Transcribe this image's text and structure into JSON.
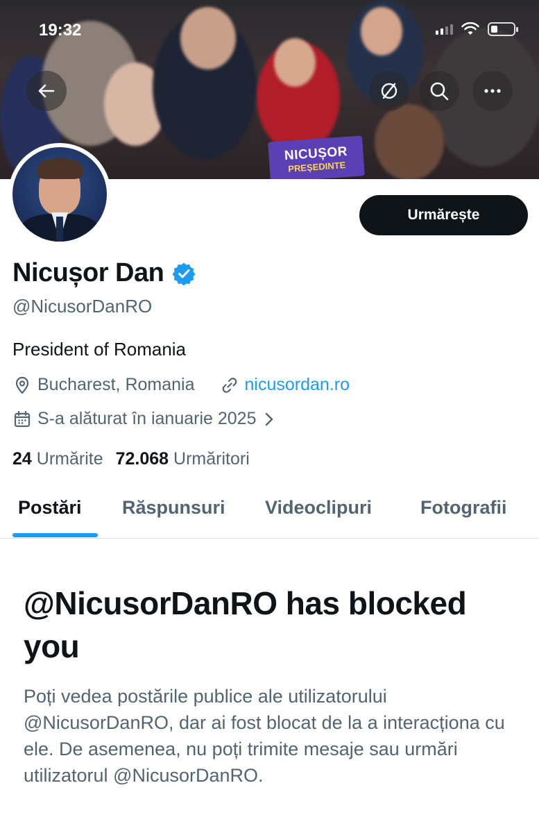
{
  "status_bar": {
    "time": "19:32"
  },
  "banner": {
    "sign_line1": "NICUȘOR",
    "sign_line2": "PREȘEDINTE"
  },
  "nav": {
    "back_icon": "arrow-left-icon",
    "blocked_icon": "circle-slash-icon",
    "search_icon": "search-icon",
    "more_icon": "more-horizontal-icon"
  },
  "profile": {
    "name": "Nicușor Dan",
    "verified": true,
    "verified_color": "#1d9bf0",
    "handle": "@NicusorDanRO",
    "bio": "President of Romania",
    "location": "Bucharest, Romania",
    "website": "nicusordan.ro",
    "joined": "S-a alăturat în ianuarie 2025",
    "follow_button": "Urmărește"
  },
  "stats": {
    "following_count": "24",
    "following_label": "Urmărite",
    "followers_count": "72.068",
    "followers_label": "Urmăritori"
  },
  "tabs": [
    {
      "label": "Postări",
      "active": true
    },
    {
      "label": "Răspunsuri",
      "active": false
    },
    {
      "label": "Videoclipuri",
      "active": false
    },
    {
      "label": "Fotografii",
      "active": false
    }
  ],
  "blocked": {
    "title": "@NicusorDanRO has blocked you",
    "body": "Poți vedea postările publice ale utilizatorului @NicusorDanRO, dar ai fost blocat de la a interacționa cu ele. De asemenea, nu poți trimite mesaje sau urmări utilizatorul @NicusorDanRO."
  },
  "colors": {
    "accent": "#1d9bf0",
    "text_primary": "#0f1419",
    "text_secondary": "#536471"
  }
}
